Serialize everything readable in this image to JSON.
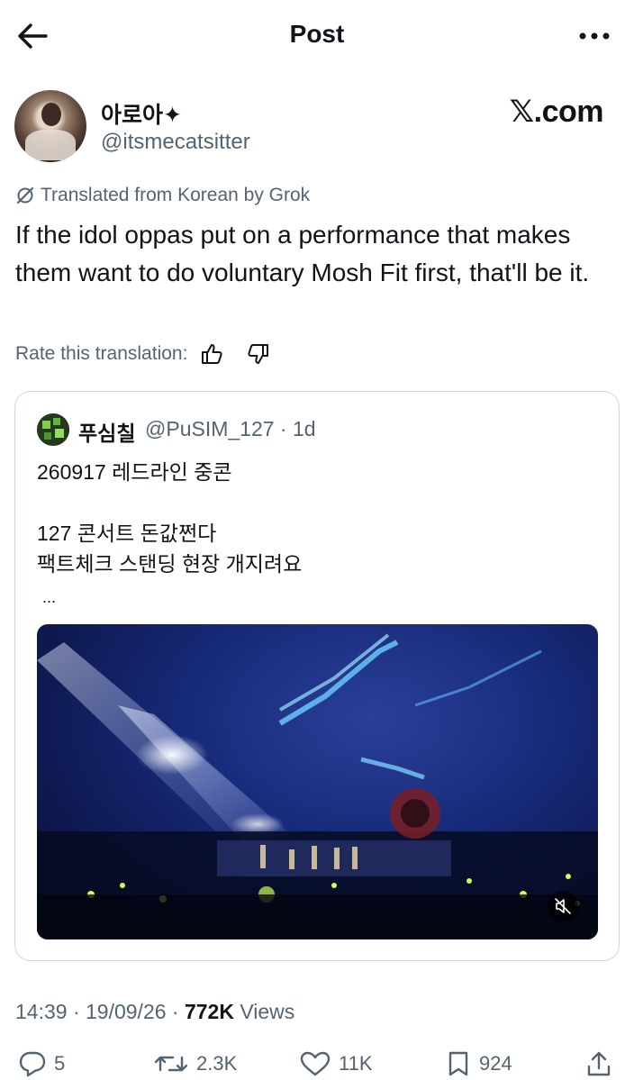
{
  "header": {
    "title": "Post",
    "back_icon": "arrow-left-icon",
    "more_icon": "more-horizontal-icon"
  },
  "author": {
    "display_name": "아로아✦",
    "handle": "@itsmecatsitter"
  },
  "watermark": "𝕏.com",
  "translation": {
    "notice": "Translated from Korean by Grok",
    "rate_label": "Rate this translation:"
  },
  "tweet": {
    "text": "If the idol oppas put on a performance that makes them want to do voluntary Mosh Fit first, that'll be it."
  },
  "quote": {
    "display_name": "푸심칠",
    "handle": "@PuSIM_127 · 1d",
    "text": "260917 레드라인 중콘\n\n127 콘서트 돈값쩐다\n팩트체크 스탠딩 현장 개지려요",
    "more": "..."
  },
  "meta": {
    "time_date": "14:39 · 19/09/26 · ",
    "views_count": "772K",
    "views_label": " Views"
  },
  "actions": {
    "replies": "5",
    "reposts": "2.3K",
    "likes": "11K",
    "bookmarks": "924"
  },
  "colors": {
    "text": "#0f1419",
    "secondary": "#536471",
    "border": "#cfd9de"
  }
}
